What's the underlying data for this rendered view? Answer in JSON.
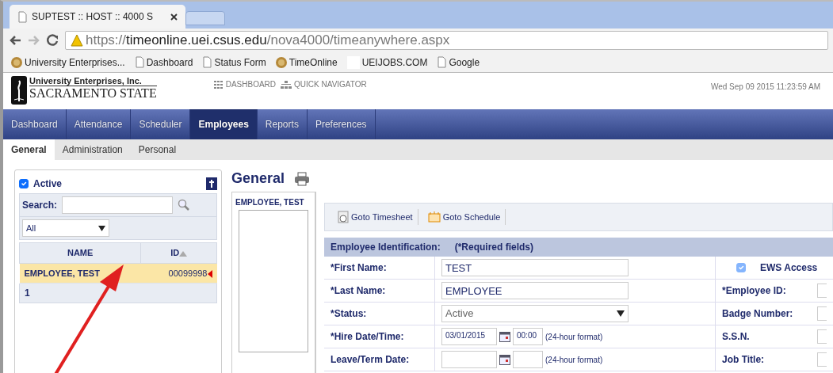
{
  "browser": {
    "tab_title": "SUPTEST :: HOST :: 4000 S",
    "url_scheme": "https://",
    "url_host": "timeonline.uei.csus.edu",
    "url_path": "/nova4000/timeanywhere.aspx",
    "bookmarks": [
      {
        "label": "University Enterprises...",
        "kind": "logo"
      },
      {
        "label": "Dashboard",
        "kind": "page"
      },
      {
        "label": "Status Form",
        "kind": "page"
      },
      {
        "label": "TimeOnline",
        "kind": "logo"
      },
      {
        "label": "UEIJOBS.COM",
        "kind": "blank"
      },
      {
        "label": "Google",
        "kind": "page"
      }
    ]
  },
  "header": {
    "logo_line1": "University Enterprises, Inc.",
    "logo_line2": "SACRAMENTO STATE",
    "links": [
      {
        "label": "DASHBOARD",
        "kind": "grid"
      },
      {
        "label": "QUICK NAVIGATOR",
        "kind": "tree"
      }
    ],
    "datetime": "Wed Sep 09 2015 11:23:59 AM"
  },
  "nav": [
    {
      "label": "Dashboard",
      "selected": false
    },
    {
      "label": "Attendance",
      "selected": false
    },
    {
      "label": "Scheduler",
      "selected": false
    },
    {
      "label": "Employees",
      "selected": true
    },
    {
      "label": "Reports",
      "selected": false
    },
    {
      "label": "Preferences",
      "selected": false
    }
  ],
  "subtabs": [
    {
      "label": "General",
      "selected": true
    },
    {
      "label": "Administration",
      "selected": false
    },
    {
      "label": "Personal",
      "selected": false
    }
  ],
  "left_panel": {
    "active_label": "Active",
    "active_checked": true,
    "search_label": "Search:",
    "filter": "All",
    "columns": [
      {
        "label": "NAME",
        "sorted": false
      },
      {
        "label": "ID",
        "sorted": true
      }
    ],
    "rows": [
      {
        "name": "EMPLOYEE, TEST",
        "id": "00099998",
        "selected": true
      }
    ],
    "pager": "1"
  },
  "main": {
    "title": "General",
    "employee_label": "EMPLOYEE, TEST",
    "toolbar": [
      {
        "label": "Goto Timesheet",
        "kind": "timesheet"
      },
      {
        "label": "Goto Schedule",
        "kind": "schedule"
      }
    ],
    "section_title": "Employee Identification:",
    "section_note": "(*Required fields)",
    "fields": [
      {
        "label": "*First Name:",
        "kind": "text",
        "value": "TEST"
      },
      {
        "label": "*Last Name:",
        "kind": "text",
        "value": "EMPLOYEE"
      },
      {
        "label": "*Status:",
        "kind": "select",
        "value": "Active"
      },
      {
        "label": "*Hire Date/Time:",
        "kind": "datetime",
        "date": "03/01/2015",
        "time": "00:00",
        "hint": "(24-hour format)"
      },
      {
        "label": "Leave/Term Date:",
        "kind": "datetime",
        "hint": "(24-hour format)"
      }
    ],
    "right_fields": [
      {
        "label": "EWS Access",
        "kind": "checkbox",
        "checked": true
      },
      {
        "label": "*Employee ID:",
        "kind": "input"
      },
      {
        "label": "Badge Number:",
        "kind": "input"
      },
      {
        "label": "S.S.N.",
        "kind": "input"
      },
      {
        "label": "Job Title:",
        "kind": "input"
      }
    ]
  }
}
